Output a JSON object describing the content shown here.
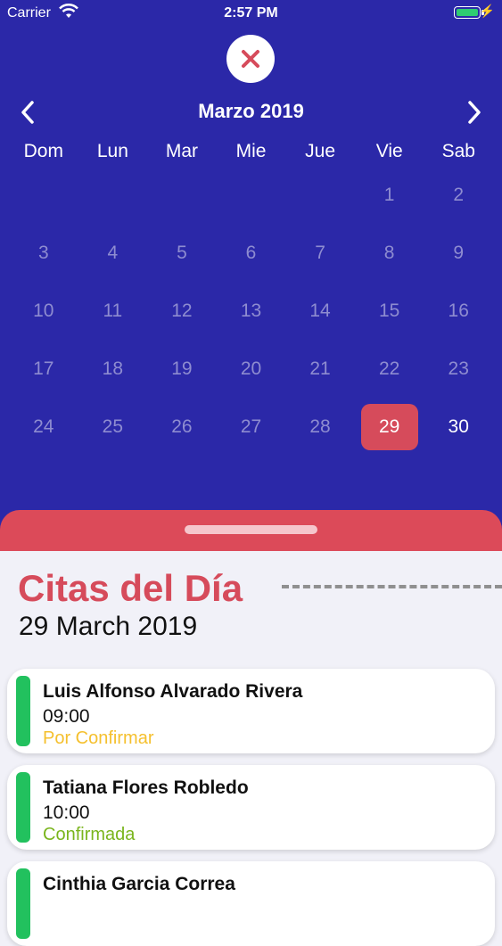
{
  "status_bar": {
    "carrier": "Carrier",
    "time": "2:57 PM"
  },
  "calendar": {
    "month_title": "Marzo 2019",
    "weekdays": [
      "Dom",
      "Lun",
      "Mar",
      "Mie",
      "Jue",
      "Vie",
      "Sab"
    ],
    "weeks": [
      [
        "",
        "",
        "",
        "",
        "",
        "1",
        "2"
      ],
      [
        "3",
        "4",
        "5",
        "6",
        "7",
        "8",
        "9"
      ],
      [
        "10",
        "11",
        "12",
        "13",
        "14",
        "15",
        "16"
      ],
      [
        "17",
        "18",
        "19",
        "20",
        "21",
        "22",
        "23"
      ],
      [
        "24",
        "25",
        "26",
        "27",
        "28",
        "29",
        "30"
      ]
    ],
    "selected_day": "29",
    "highlight_day": "30"
  },
  "appointments": {
    "section_title": "Citas del Día",
    "date": "29 March 2019",
    "items": [
      {
        "name": "Luis Alfonso Alvarado Rivera",
        "time": "09:00",
        "status": "Por Confirmar",
        "status_color": "#f5c02e"
      },
      {
        "name": "Tatiana Flores Robledo",
        "time": "10:00",
        "status": "Confirmada",
        "status_color": "#7ab51d"
      },
      {
        "name": "Cinthia Garcia Correa",
        "time": "",
        "status": "",
        "status_color": "#7ab51d"
      }
    ]
  },
  "colors": {
    "calendar_bg": "#2b28a8",
    "accent_red": "#d64b5b",
    "accent_green": "#22c15e"
  }
}
